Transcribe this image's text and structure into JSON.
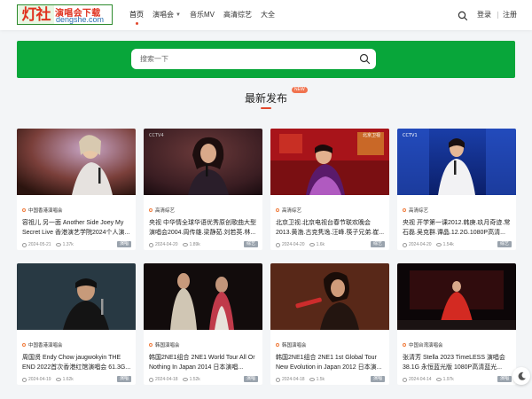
{
  "logo": {
    "mark": "灯社",
    "cn": "演唱会下载",
    "en": "dengshe.com"
  },
  "nav": [
    {
      "label": "首页"
    },
    {
      "label": "演唱会"
    },
    {
      "label": "音乐MV"
    },
    {
      "label": "高清综艺"
    },
    {
      "label": "大全"
    }
  ],
  "header": {
    "login": "登录",
    "register": "注册"
  },
  "search": {
    "placeholder": "搜索一下"
  },
  "section": {
    "title": "最新发布",
    "badge": "NEW"
  },
  "cards": [
    {
      "category": "中国香港演唱会",
      "title": "容祖儿 另一面 Another Side Joey My Secret Live 香港演艺学院2024个人演...",
      "date": "2024-05-21",
      "views": "1.37k",
      "tag": "演唱"
    },
    {
      "category": "高清综艺",
      "title": "央视 中华情全球华语优秀原创歌曲大型演唱会2004.周传雄.梁静茹.刘若英.林...",
      "date": "2024-04-20",
      "views": "1.89k",
      "tag": "综艺"
    },
    {
      "category": "高清综艺",
      "title": "北京卫视.北京电视台春节联欢晚会2013.黄渤.古克隽逸.汪峰.筷子兄弟.崔...",
      "date": "2024-04-20",
      "views": "1.6k",
      "tag": "综艺"
    },
    {
      "category": "高清综艺",
      "title": "央视 开学第一课2012.韩庚.玖月奇迹.常石磊.吴克群.谭晶.12.2G.1080P高清...",
      "date": "2024-04-20",
      "views": "1.54k",
      "tag": "综艺"
    },
    {
      "category": "中国香港演唱会",
      "title": "周国贤 Endy Chow jaugwokyin THE END 2022首次香港红馆演唱会 61.3G...",
      "date": "2024-04-19",
      "views": "1.62k",
      "tag": "演唱"
    },
    {
      "category": "韩国演唱会",
      "title": "韩国2NE1组合 2NE1 World Tour All Or Nothing In Japan 2014 日本演唱...",
      "date": "2024-04-18",
      "views": "1.52k",
      "tag": "演唱"
    },
    {
      "category": "韩国演唱会",
      "title": "韩国2NE1组合 2NE1 1st Global Tour New Evolution in Japan 2012 日本演...",
      "date": "2024-04-18",
      "views": "1.5k",
      "tag": "演唱"
    },
    {
      "category": "中国台湾演唱会",
      "title": "张清芳 Stella 2023 TimeLESS 演唱会 38.1G 永恒蓝光版 1080P高清蓝光...",
      "date": "2024-04-14",
      "views": "1.97k",
      "tag": "演唱"
    }
  ],
  "colors": {
    "brand_green": "#08a63a",
    "accent": "#e2482d",
    "badge": "#f0734f"
  }
}
